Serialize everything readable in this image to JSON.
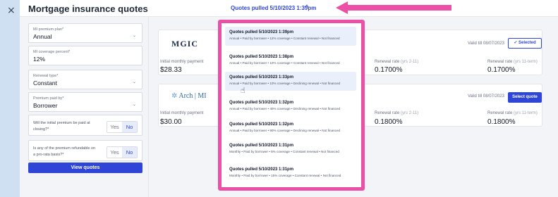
{
  "header": {
    "title": "Mortgage insurance quotes",
    "pulled_label": "Quotes pulled 5/10/2023 1:39pm",
    "close_glyph": "×",
    "caret_glyph": "^",
    "accent": "#2f45d8",
    "highlight": "#ec4fa6"
  },
  "form": {
    "fields": [
      {
        "label": "MI premium plan*",
        "value": "Annual",
        "has_chevron": true
      },
      {
        "label": "MI coverage percent*",
        "value": "12%",
        "has_chevron": false
      },
      {
        "label": "Renewal type*",
        "value": "Constant",
        "has_chevron": true
      },
      {
        "label": "Premium paid by*",
        "value": "Borrower",
        "has_chevron": true
      }
    ],
    "questions": [
      {
        "text": "Will the initial premium be paid at closing?*",
        "yes": "Yes",
        "no": "No",
        "selected": "No"
      },
      {
        "text": "Is any of the premium refundable on a pro-rata basis?*",
        "yes": "Yes",
        "no": "No",
        "selected": "No"
      }
    ],
    "view_button": "View quotes"
  },
  "quotes": [
    {
      "logo": "MGIC",
      "initial_label": "Initial monthly payment",
      "initial_value": "$28.33",
      "renewal_2_11_label": "Renewal rate",
      "renewal_2_11_note": "(yrs 2-11)",
      "renewal_2_11_value": "0.1700%",
      "renewal_11_term_label": "Renewal rate",
      "renewal_11_term_note": "(yrs 11-term)",
      "renewal_11_term_value": "0.1700%",
      "valid": "Valid till 08/07/2023",
      "button": "✓ Selected"
    },
    {
      "logo": "Arch | MI",
      "initial_label": "Initial monthly payment",
      "initial_value": "$30.00",
      "renewal_2_11_label": "Renewal rate",
      "renewal_2_11_note": "(yrs 2-11)",
      "renewal_2_11_value": "0.1800%",
      "renewal_11_term_label": "Renewal rate",
      "renewal_11_term_note": "(yrs 11-term)",
      "renewal_11_term_value": "0.1800%",
      "valid": "Valid till 08/07/2023",
      "button": "Select quote"
    }
  ],
  "dropdown": {
    "items": [
      {
        "title": "Quotes pulled 5/10/2023 1:39pm",
        "details": "Annual • Paid by borrower • 12% coverage • Constant renewal • Not financed",
        "active": true
      },
      {
        "title": "Quotes pulled 5/10/2023 1:38pm",
        "details": "Annual • Paid by borrower • 10% coverage • Constant renewal • Not financed",
        "active": false
      },
      {
        "title": "Quotes pulled 5/10/2023 1:33pm",
        "details": "Annual • Paid by borrower • 10% coverage • Declining renewal • Not financed",
        "active": true
      },
      {
        "title": "Quotes pulled 5/10/2023 1:32pm",
        "details": "Annual • Paid by borrower • 40% coverage • Declining renewal • Not financed",
        "active": false
      },
      {
        "title": "Quotes pulled 5/10/2023 1:32pm",
        "details": "Annual • Paid by borrower • 90% coverage • Declining renewal • Not financed",
        "active": false
      },
      {
        "title": "Quotes pulled 5/10/2023 1:31pm",
        "details": "Monthly • Paid by borrower • 5% coverage • Constant renewal • Not financed",
        "active": false
      },
      {
        "title": "Quotes pulled 5/10/2023 1:31pm",
        "details": "Monthly • Paid by borrower • 15% coverage • Constant renewal • Not financed",
        "active": false
      }
    ]
  }
}
